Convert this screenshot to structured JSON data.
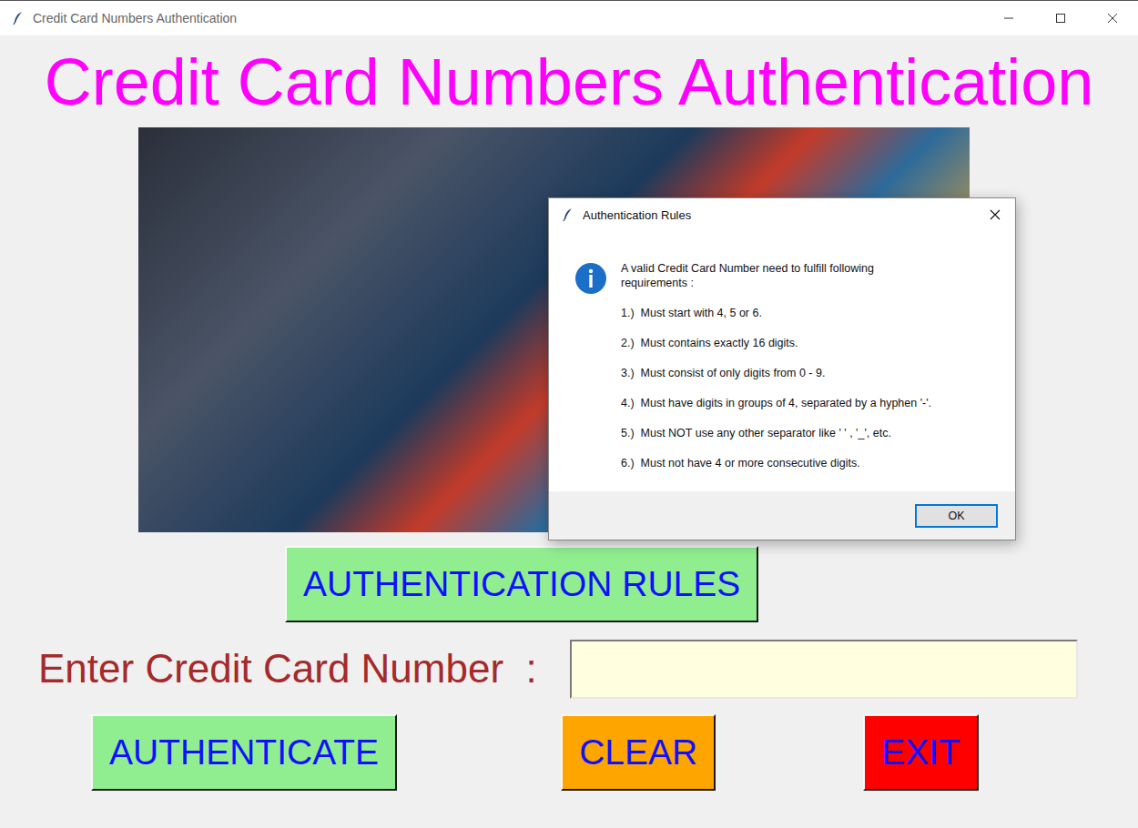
{
  "window": {
    "title": "Credit Card Numbers Authentication"
  },
  "heading": "Credit Card Numbers Authentication",
  "rules_button": "AUTHENTICATION RULES",
  "entry": {
    "label": "Enter Credit Card Number  :",
    "value": ""
  },
  "buttons": [
    {
      "label": "AUTHENTICATE",
      "color": "#90ee90"
    },
    {
      "label": "CLEAR",
      "color": "#ffa500"
    },
    {
      "label": "EXIT",
      "color": "#ff0000"
    }
  ],
  "dialog": {
    "title": "Authentication Rules",
    "intro": "A valid Credit Card Number need to fulfill following requirements :",
    "rules": [
      "1.)  Must start with 4, 5 or 6.",
      "2.)  Must contains exactly 16 digits.",
      "3.)  Must consist of only digits from 0 - 9.",
      "4.)  Must have digits in groups of 4, separated by a hyphen '-'.",
      "5.)  Must NOT use any other separator like ' ' , '_', etc.",
      "6.)  Must not have 4 or more consecutive digits."
    ],
    "button": "OK"
  }
}
